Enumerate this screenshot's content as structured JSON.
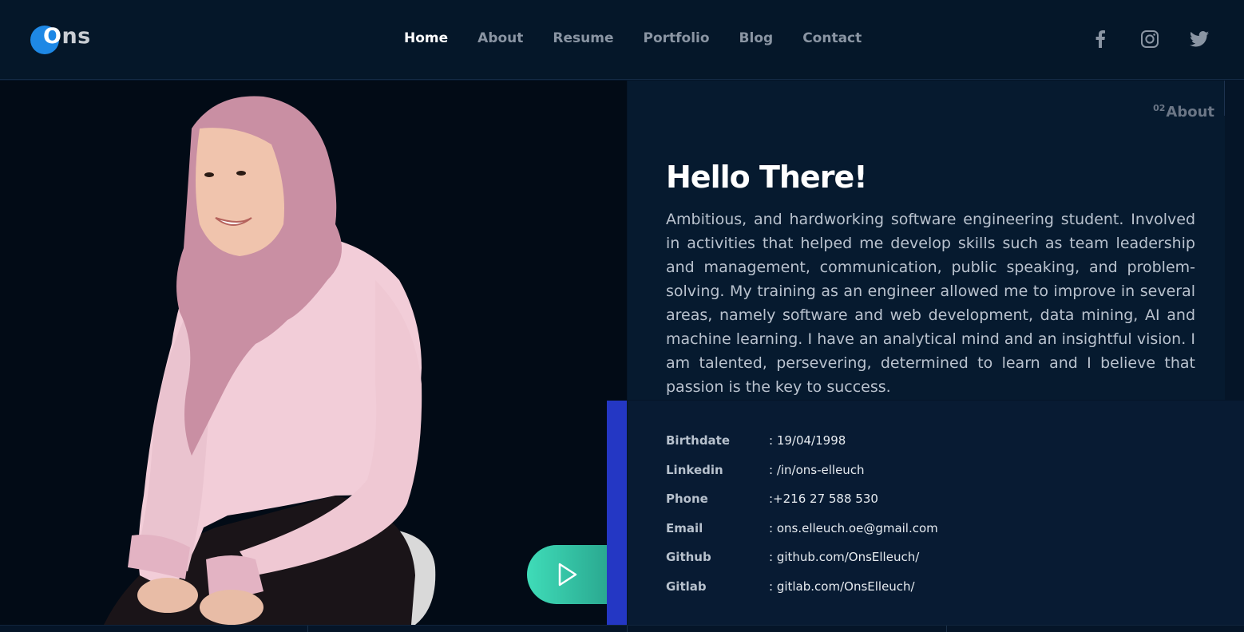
{
  "header": {
    "logo_initial": "O",
    "logo_rest": "ns",
    "nav": [
      {
        "label": "Home",
        "active": true
      },
      {
        "label": "About",
        "active": false
      },
      {
        "label": "Resume",
        "active": false
      },
      {
        "label": "Portfolio",
        "active": false
      },
      {
        "label": "Blog",
        "active": false
      },
      {
        "label": "Contact",
        "active": false
      }
    ],
    "social_icons": [
      "facebook-icon",
      "instagram-icon",
      "twitter-icon"
    ]
  },
  "about": {
    "section_number": "02",
    "section_label": "About",
    "heading": "Hello There!",
    "bio": "Ambitious, and hardworking software engineering student. Involved in activities that helped me develop skills such as team leadership and management, communication, public speaking, and problem-solving. My training as an engineer allowed me to improve in several areas, namely software and web development, data mining, AI and machine learning. I have an analytical mind and an insightful vision. I am talented, persevering, determined to learn and I believe that passion is the key to success."
  },
  "info": [
    {
      "label": "Birthdate",
      "value": ": 19/04/1998"
    },
    {
      "label": "Linkedin",
      "value": ": /in/ons-elleuch"
    },
    {
      "label": "Phone",
      "value": ":+216 27 588 530"
    },
    {
      "label": "Email",
      "value": ": ons.elleuch.oe@gmail.com"
    },
    {
      "label": "Github",
      "value": ": github.com/OnsElleuch/"
    },
    {
      "label": "Gitlab",
      "value": ": gitlab.com/OnsElleuch/"
    }
  ],
  "colors": {
    "background": "#051528",
    "accent_blue": "#2437c4",
    "play_gradient_start": "#3fdcb8",
    "play_gradient_end": "#2aa890",
    "logo_blue": "#1e88e5"
  },
  "photo": {
    "icon": "profile-photo"
  },
  "play_button": {
    "icon": "play-icon"
  }
}
